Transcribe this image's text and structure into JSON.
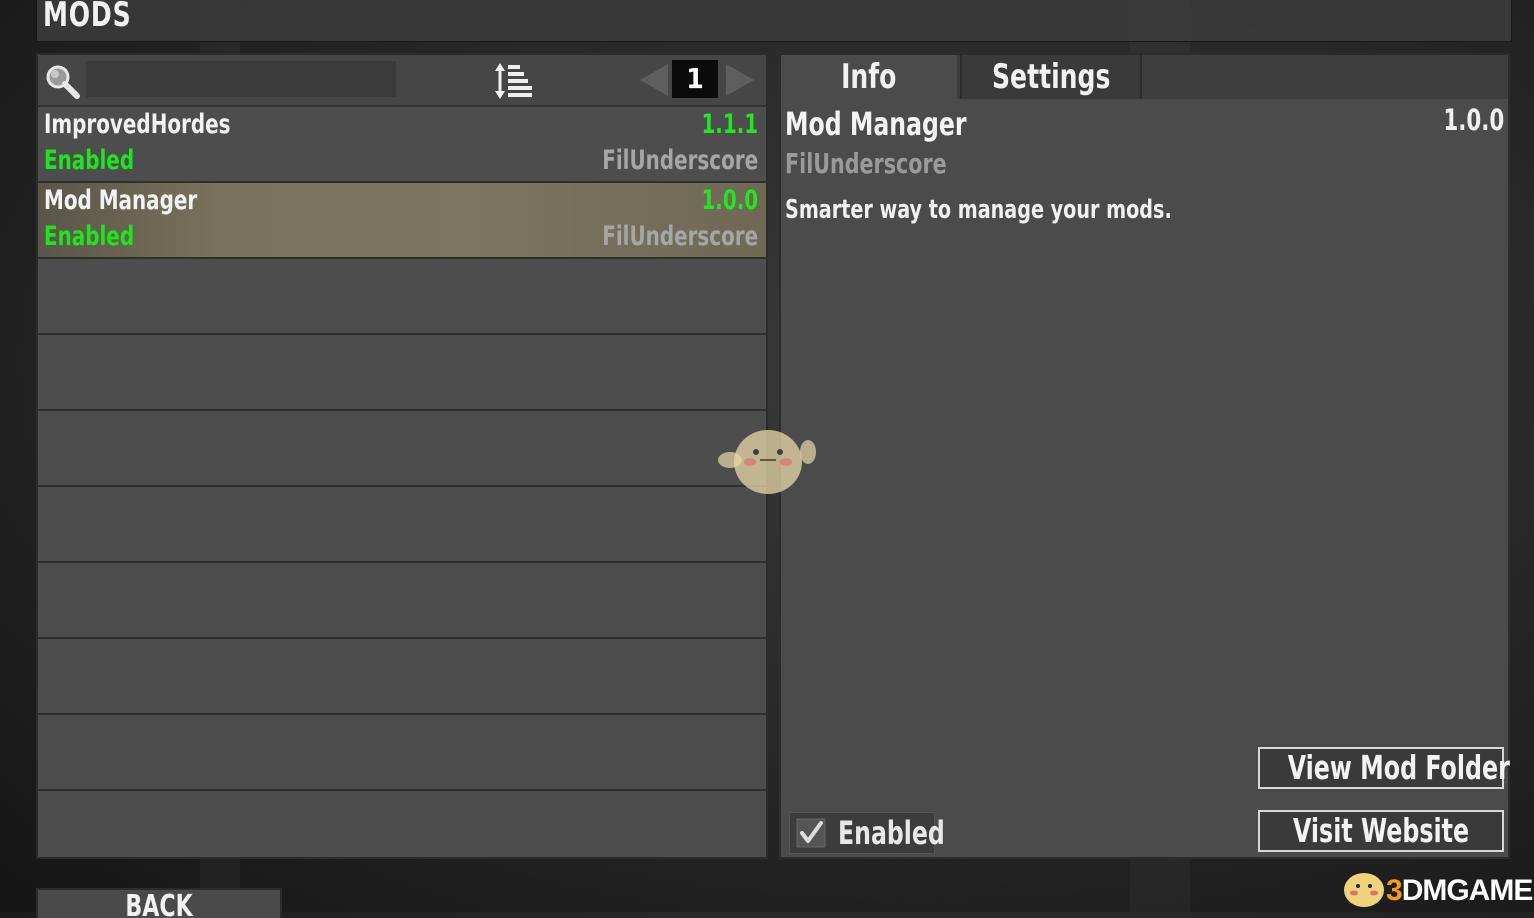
{
  "header": {
    "title": "MODS"
  },
  "toolbar": {
    "search_placeholder": "",
    "search_icon": "search-icon",
    "sort_icon": "sort-list-icon",
    "page_number": "1"
  },
  "mods": [
    {
      "name": "ImprovedHordes",
      "version": "1.1.1",
      "status": "Enabled",
      "author": "FilUnderscore"
    },
    {
      "name": "Mod Manager",
      "version": "1.0.0",
      "status": "Enabled",
      "author": "FilUnderscore"
    }
  ],
  "tabs": {
    "info": "Info",
    "settings": "Settings"
  },
  "details": {
    "name": "Mod Manager",
    "version": "1.0.0",
    "author": "FilUnderscore",
    "description": "Smarter way to manage your mods.",
    "enabled_label": "Enabled",
    "view_folder_label": "View Mod Folder",
    "visit_website_label": "Visit Website"
  },
  "footer": {
    "back_label": "BACK"
  },
  "watermark": {
    "text_3": "3",
    "text_rest": "DMGAME"
  },
  "colors": {
    "status_green": "#22e622",
    "author_gray": "#a6a6a6",
    "selected_row": "#7a725c"
  }
}
